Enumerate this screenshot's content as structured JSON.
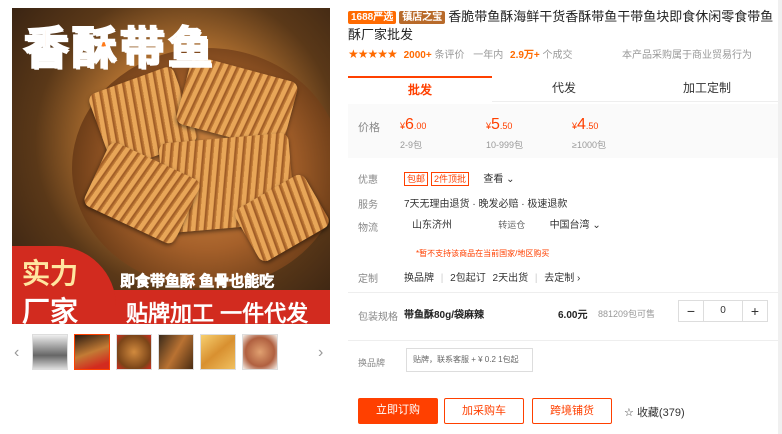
{
  "gallery": {
    "headline": "香酥带鱼",
    "promo_big_1": "实力",
    "promo_big_2": "厂家",
    "promo_top": "即食带鱼酥 鱼骨也能吃",
    "promo_bottom": "贴牌加工 一件代发",
    "prev_arrow": "‹",
    "next_arrow": "›"
  },
  "product": {
    "tag_1688": "1688严选",
    "tag_shop": "镇店之宝",
    "title": "香脆带鱼酥海鲜干货香酥带鱼干带鱼块即食休闲零食带鱼酥厂家批发"
  },
  "rating": {
    "stars": "★★★★★",
    "count": "2000+",
    "count_label": "条评价",
    "sold_label": "一年内",
    "sold": "2.9万+",
    "sold_unit": "个成交",
    "right_note": "本产品采购属于商业贸易行为"
  },
  "tabs": [
    "批发",
    "代发",
    "加工定制"
  ],
  "price": {
    "label": "价格",
    "tiers": [
      {
        "symbol": "¥",
        "int": "6",
        "dec": ".00",
        "qty": "2-9包"
      },
      {
        "symbol": "¥",
        "int": "5",
        "dec": ".50",
        "qty": "10-999包"
      },
      {
        "symbol": "¥",
        "int": "4",
        "dec": ".50",
        "qty": "≥1000包"
      }
    ]
  },
  "promo": {
    "label": "优惠",
    "chip1": "包邮",
    "chip2": "2件顶批",
    "view": "查看"
  },
  "service": {
    "label": "服务",
    "text": "7天无理由退货 · 晚发必赔 · 极速退款"
  },
  "logistics": {
    "label": "物流",
    "from": "山东济州",
    "mode": "转运仓",
    "to": "中国台湾",
    "warning": "*暂不支持该商品在当前国家/地区购买"
  },
  "custom": {
    "label": "定制",
    "swap": "换品牌",
    "min": "2包起订",
    "days": "2天出货",
    "link": "去定制"
  },
  "variant": {
    "label": "包装规格",
    "name": "带鱼酥80g/袋麻辣",
    "price": "6.00元",
    "stock": "881209包可售",
    "qty": "0",
    "minus": "−",
    "plus": "+"
  },
  "swap_brand": {
    "label": "换品牌",
    "chip": "贴牌，联系客服 + ¥ 0.2  1包起"
  },
  "actions": {
    "buy": "立即订购",
    "cart": "加采购车",
    "distribute": "跨境铺货",
    "fav_icon": "☆",
    "fav": "收藏(379)"
  }
}
